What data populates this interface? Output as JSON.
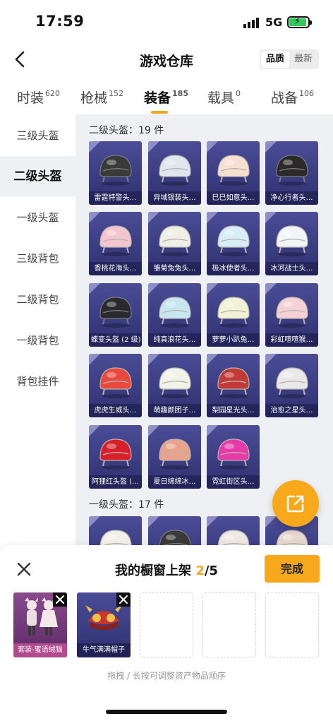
{
  "status": {
    "time": "17:59",
    "network": "5G"
  },
  "header": {
    "title": "游戏仓库",
    "sort_options": [
      "品质",
      "最新"
    ],
    "sort_selected": "品质"
  },
  "tabs": [
    {
      "label": "时装",
      "count": "620"
    },
    {
      "label": "枪械",
      "count": "152"
    },
    {
      "label": "装备",
      "count": "185"
    },
    {
      "label": "载具",
      "count": "0"
    },
    {
      "label": "战备",
      "count": "106"
    }
  ],
  "active_tab": "装备",
  "sidebar": {
    "items": [
      "三级头盔",
      "二级头盔",
      "一级头盔",
      "三级背包",
      "二级背包",
      "一级背包",
      "背包挂件"
    ],
    "active": "二级头盔"
  },
  "sections": [
    {
      "title": "二级头盔：19 件",
      "items": [
        {
          "name": "雷霆特警头…",
          "color": "#3a3a3a"
        },
        {
          "name": "异域银装头…",
          "color": "#dfe6ee"
        },
        {
          "name": "巳巳如意头…",
          "color": "#f6e0d0"
        },
        {
          "name": "净心行者头…",
          "color": "#2c2a28"
        },
        {
          "name": "香桃花海头…",
          "color": "#f3c6cf"
        },
        {
          "name": "雏菊兔兔头…",
          "color": "#efefe6"
        },
        {
          "name": "极冰使者头…",
          "color": "#d7eef8"
        },
        {
          "name": "冰河战士头…",
          "color": "#f2f4f8"
        },
        {
          "name": "蝶变头盔 (2 级)",
          "color": "#2a2a2e"
        },
        {
          "name": "纯真浪花头…",
          "color": "#c7e6f0"
        },
        {
          "name": "萝萝小趴兔…",
          "color": "#f1f1d6"
        },
        {
          "name": "彩虹嘻嘻猴…",
          "color": "#f5d0d4"
        },
        {
          "name": "虎虎生威头…",
          "color": "#e8493c"
        },
        {
          "name": "萌趣颜团子…",
          "color": "#f2f3e8"
        },
        {
          "name": "梨园星光头…",
          "color": "#c23a36"
        },
        {
          "name": "治愈之星头…",
          "color": "#e9e9ea"
        },
        {
          "name": "阿狸红头盔 (…",
          "color": "#d8202a"
        },
        {
          "name": "夏日绵绵冰…",
          "color": "#e9a38a"
        },
        {
          "name": "霓虹街区头…",
          "color": "#e53aa8"
        }
      ]
    },
    {
      "title": "一级头盔：17 件",
      "items": [
        {
          "name": "",
          "color": "#f3efe9"
        },
        {
          "name": "",
          "color": "#3a3a3a"
        },
        {
          "name": "",
          "color": "#efe8e2"
        },
        {
          "name": "",
          "color": "#e9d8d0"
        }
      ]
    }
  ],
  "showcase": {
    "title_prefix": "我的橱窗上架",
    "current": "2",
    "total": "/5",
    "done_label": "完成",
    "slots": [
      {
        "label": "套装-蜜语绒猫",
        "bg": "#7a3a7a"
      },
      {
        "label": "牛气满满帽子",
        "bg": "#3c3f86"
      }
    ],
    "empty_slots": 3,
    "hint": "拖拽 / 长按可调整资产物品顺序"
  }
}
